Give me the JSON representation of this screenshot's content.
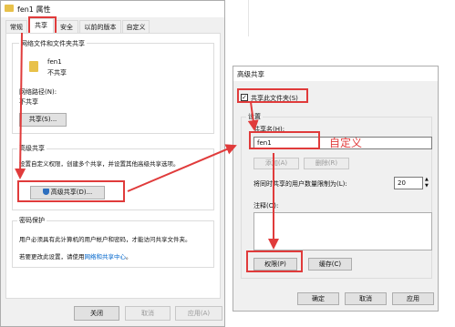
{
  "props_dialog": {
    "title": "fen1 属性",
    "tabs": [
      "常规",
      "共享",
      "安全",
      "以前的版本",
      "自定义"
    ],
    "net_group_title": "网络文件和文件夹共享",
    "folder_name": "fen1",
    "folder_status": "不共享",
    "net_path_label": "网络路径(N):",
    "net_path_value": "不共享",
    "share_button": "共享(S)...",
    "adv_title": "高级共享",
    "adv_desc": "设置自定义权限，创建多个共享，并设置其他高级共享选项。",
    "adv_button": "高级共享(D)...",
    "pw_title": "密码保护",
    "pw_desc": "用户必须具有此计算机的用户帐户和密码，才能访问共享文件夹。",
    "pw_link_prefix": "若要更改此设置，请使用",
    "pw_link": "网络和共享中心",
    "pw_link_suffix": "。",
    "close_btn": "关闭",
    "cancel_btn": "取消",
    "apply_btn": "应用(A)"
  },
  "adv_dialog": {
    "title": "高级共享",
    "share_checkbox_label": "共享此文件夹(S)",
    "share_checked": true,
    "settings_label": "设置",
    "share_name_label": "共享名(H):",
    "share_name_value": "fen1",
    "add_btn": "添加(A)",
    "delete_btn": "删除(R)",
    "limit_label": "将同时共享的用户数量限制为(L):",
    "limit_value": "20",
    "comment_label": "注释(O):",
    "perm_btn": "权限(P)",
    "cache_btn": "缓存(C)",
    "ok_btn": "确定",
    "cancel_btn": "取消",
    "apply_btn": "应用"
  },
  "annotation": {
    "custom_text": "自定义",
    "color": "#e03b3b"
  }
}
